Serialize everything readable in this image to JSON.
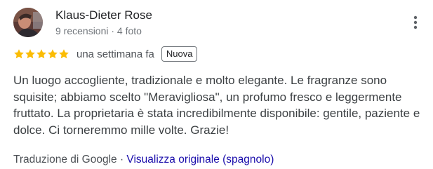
{
  "review": {
    "author": {
      "name": "Klaus-Dieter Rose",
      "meta": "9 recensioni · 4 foto",
      "avatar_icon": "avatar-photo"
    },
    "rating": {
      "stars": 5,
      "max_stars": 5,
      "star_color": "#fbbc04",
      "time_ago": "una settimana fa",
      "badge": "Nuova"
    },
    "text": "Un luogo accogliente, tradizionale e molto elegante. Le fragranze sono squisite; abbiamo scelto \"Meravigliosa\", un profumo fresco e leggermente fruttato. La proprietaria è stata incredibilmente disponibile: gentile, paziente e dolce. Ci torneremmo mille volte. Grazie!",
    "translation": {
      "source": "Traduzione di Google",
      "separator": " · ",
      "view_original": "Visualizza originale (spagnolo)"
    },
    "more_icon": "more-vert-icon",
    "link_color": "#1a0dab"
  }
}
